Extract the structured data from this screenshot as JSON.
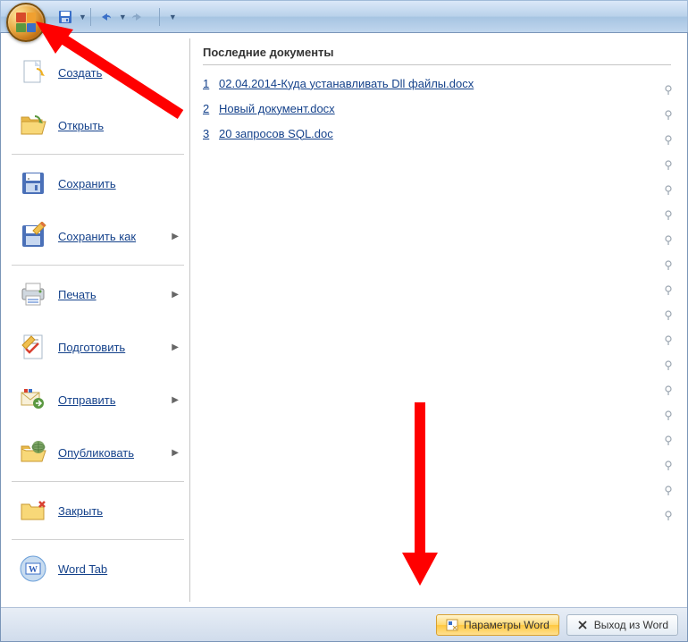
{
  "titlebar": {
    "qat": {
      "save": "save-icon",
      "undo": "undo-icon",
      "redo": "redo-icon"
    }
  },
  "menu": {
    "items": [
      {
        "label": "Создать",
        "icon": "new",
        "arrow": false
      },
      {
        "label": "Открыть",
        "icon": "open",
        "arrow": false
      },
      {
        "label": "Сохранить",
        "icon": "save",
        "arrow": false
      },
      {
        "label": "Сохранить как",
        "icon": "saveas",
        "arrow": true
      },
      {
        "label": "Печать",
        "icon": "print",
        "arrow": true
      },
      {
        "label": "Подготовить",
        "icon": "prepare",
        "arrow": true
      },
      {
        "label": "Отправить",
        "icon": "send",
        "arrow": true
      },
      {
        "label": "Опубликовать",
        "icon": "publish",
        "arrow": true
      },
      {
        "label": "Закрыть",
        "icon": "close",
        "arrow": false
      },
      {
        "label": "Word Tab",
        "icon": "wordtab",
        "arrow": false
      }
    ]
  },
  "recent": {
    "title": "Последние документы",
    "items": [
      {
        "n": "1",
        "name": "02.04.2014-Куда устанавливать Dll файлы.docx"
      },
      {
        "n": "2",
        "name": "Новый документ.docx"
      },
      {
        "n": "3",
        "name": "20 запросов SQL.doc"
      }
    ],
    "pin_rows": 18
  },
  "footer": {
    "options": "Параметры Word",
    "exit": "Выход из Word"
  }
}
